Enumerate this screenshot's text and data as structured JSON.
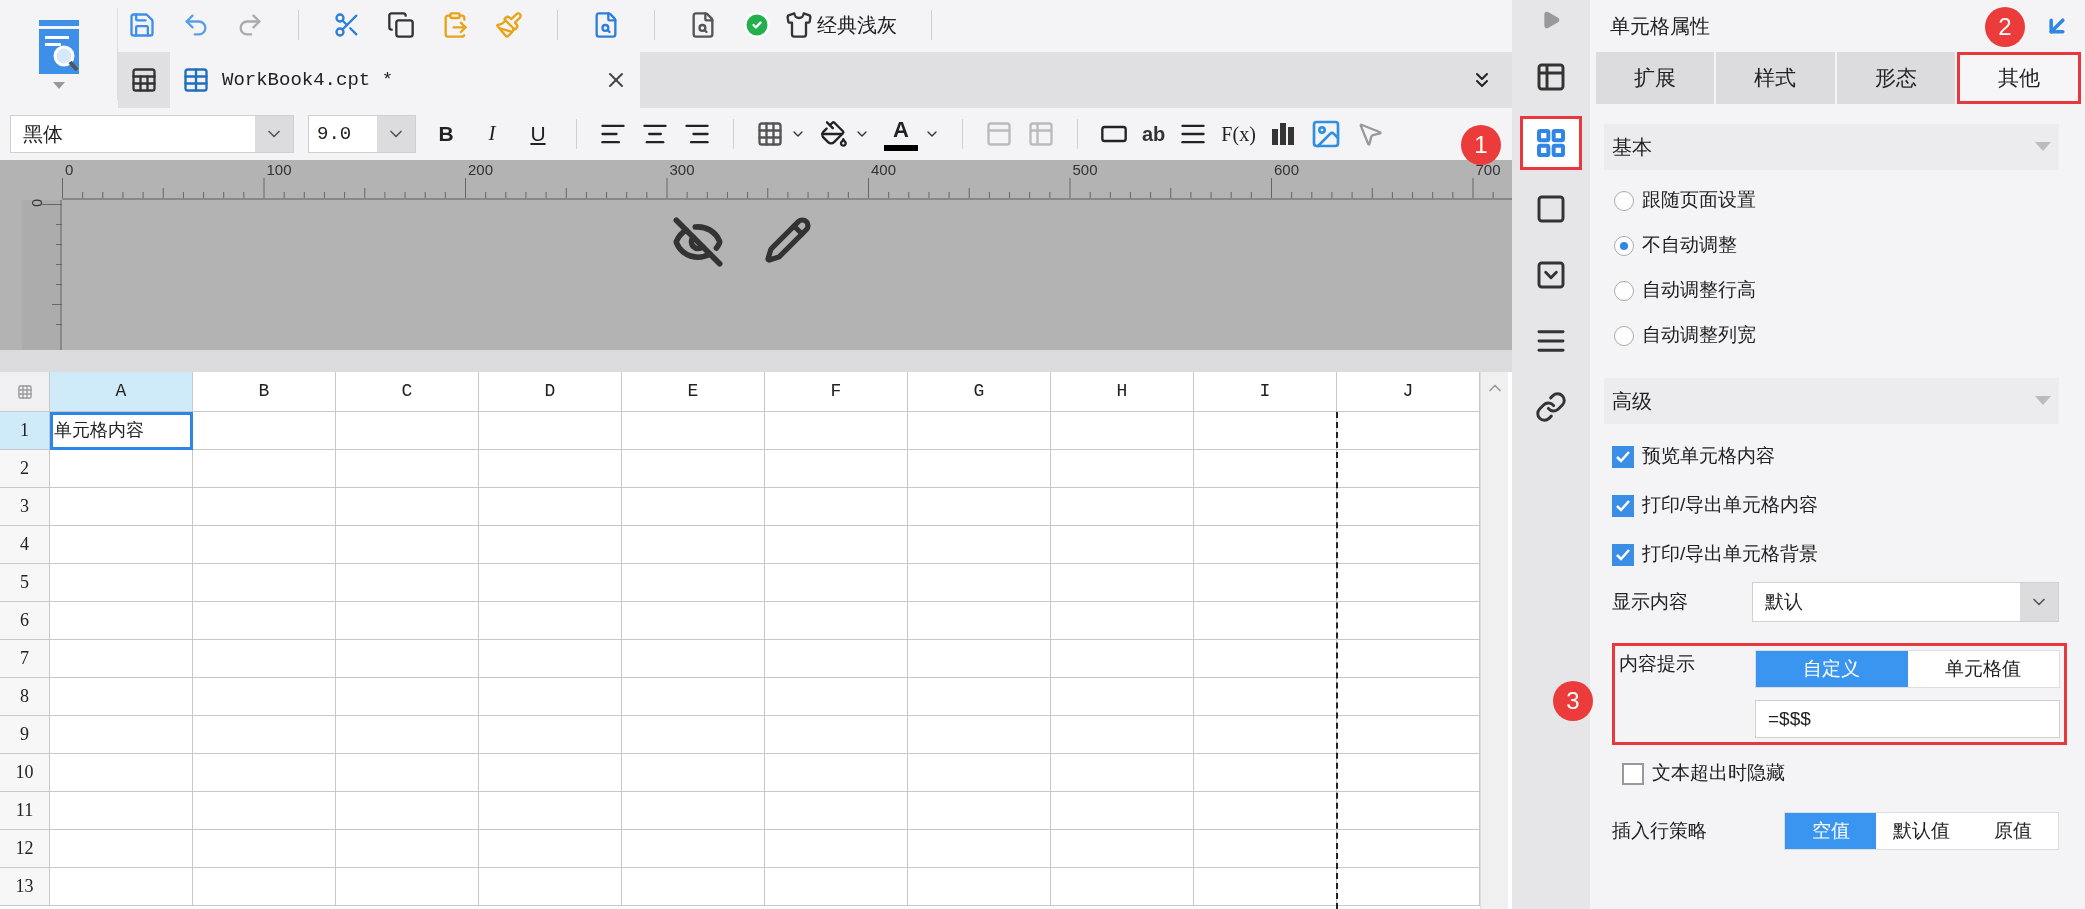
{
  "toolbar": {
    "theme_label": "经典浅灰"
  },
  "file_tab": {
    "title": "WorkBook4.cpt *",
    "selected": true
  },
  "format_bar": {
    "font": "黑体",
    "size": "9.0",
    "style_buttons": [
      "B",
      "I",
      "U"
    ],
    "font_color_glyph": "A",
    "text_glyph": "ab",
    "formula_glyph": "F(x)"
  },
  "ruler": {
    "top_labels": [
      "0",
      "100",
      "200",
      "300",
      "400",
      "500",
      "600",
      "700"
    ],
    "left_label": "0"
  },
  "sheet": {
    "columns": [
      {
        "label": "A",
        "selected": true,
        "page_break": false
      },
      {
        "label": "B",
        "selected": false,
        "page_break": false
      },
      {
        "label": "C",
        "selected": false,
        "page_break": false
      },
      {
        "label": "D",
        "selected": false,
        "page_break": false
      },
      {
        "label": "E",
        "selected": false,
        "page_break": false
      },
      {
        "label": "F",
        "selected": false,
        "page_break": false
      },
      {
        "label": "G",
        "selected": false,
        "page_break": false
      },
      {
        "label": "H",
        "selected": false,
        "page_break": false
      },
      {
        "label": "I",
        "selected": false,
        "page_break": true
      },
      {
        "label": "J",
        "selected": false,
        "page_break": false
      }
    ],
    "rows": [
      {
        "label": "1",
        "selected": true,
        "cells": [
          "单元格内容"
        ]
      },
      {
        "label": "2",
        "selected": false
      },
      {
        "label": "3",
        "selected": false
      },
      {
        "label": "4",
        "selected": false
      },
      {
        "label": "5",
        "selected": false
      },
      {
        "label": "6",
        "selected": false
      },
      {
        "label": "7",
        "selected": false
      },
      {
        "label": "8",
        "selected": false
      },
      {
        "label": "9",
        "selected": false
      },
      {
        "label": "10",
        "selected": false
      },
      {
        "label": "11",
        "selected": false
      },
      {
        "label": "12",
        "selected": false
      },
      {
        "label": "13",
        "selected": false
      }
    ]
  },
  "side_rail": {
    "items": [
      {
        "selected": false,
        "highlighted": false
      },
      {
        "selected": true,
        "highlighted": true
      },
      {
        "selected": false,
        "highlighted": false
      },
      {
        "selected": false,
        "highlighted": false
      },
      {
        "selected": false,
        "highlighted": false
      },
      {
        "selected": false,
        "highlighted": false
      }
    ]
  },
  "panel": {
    "title": "单元格属性",
    "tabs": [
      {
        "label": "扩展",
        "selected": false,
        "highlighted": false
      },
      {
        "label": "样式",
        "selected": false,
        "highlighted": false
      },
      {
        "label": "形态",
        "selected": false,
        "highlighted": false
      },
      {
        "label": "其他",
        "selected": true,
        "highlighted": true
      }
    ],
    "basic": {
      "title": "基本",
      "expanded": true,
      "options": [
        {
          "label": "跟随页面设置",
          "selected": false
        },
        {
          "label": "不自动调整",
          "selected": true
        },
        {
          "label": "自动调整行高",
          "selected": false
        },
        {
          "label": "自动调整列宽",
          "selected": false
        }
      ]
    },
    "advanced": {
      "title": "高级",
      "expanded": true,
      "checkboxes": [
        {
          "label": "预览单元格内容",
          "checked": true
        },
        {
          "label": "打印/导出单元格内容",
          "checked": true
        },
        {
          "label": "打印/导出单元格背景",
          "checked": true
        }
      ],
      "display": {
        "label": "显示内容",
        "value": "默认"
      },
      "content_hint": {
        "label": "内容提示",
        "highlighted": true,
        "options": [
          {
            "label": "自定义",
            "selected": true
          },
          {
            "label": "单元格值",
            "selected": false
          }
        ],
        "value": "=$$$"
      },
      "hide_overflow": {
        "label": "文本超出时隐藏",
        "checked": false
      },
      "insert_policy": {
        "label": "插入行策略",
        "options": [
          {
            "label": "空值",
            "selected": true
          },
          {
            "label": "默认值",
            "selected": false
          },
          {
            "label": "原值",
            "selected": false
          }
        ]
      }
    }
  },
  "annotations": [
    {
      "label": "1"
    },
    {
      "label": "2"
    },
    {
      "label": "3"
    }
  ]
}
